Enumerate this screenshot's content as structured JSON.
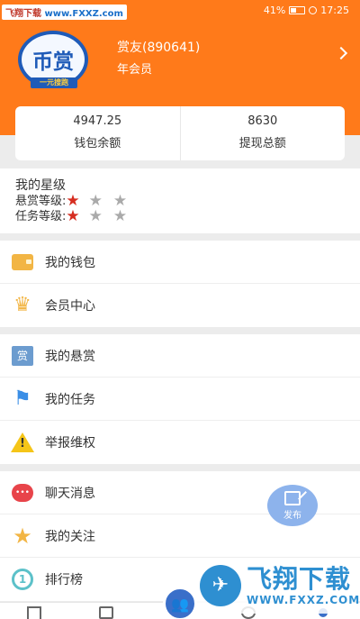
{
  "status_bar": {
    "watermark_name": "飞翔下载",
    "watermark_url": "www.FXXZ.com",
    "battery": "41%",
    "time": "17:25"
  },
  "profile": {
    "avatar_text": "币赏",
    "avatar_ribbon": "一元搜跑",
    "name": "赏友(890641)",
    "membership": "年会员"
  },
  "stats": [
    {
      "value": "4947.25",
      "label": "钱包余额"
    },
    {
      "value": "8630",
      "label": "提现总额"
    }
  ],
  "rating": {
    "title": "我的星级",
    "rows": [
      {
        "label": "悬赏等级:",
        "filled": 1,
        "total": 3
      },
      {
        "label": "任务等级:",
        "filled": 1,
        "total": 3
      }
    ]
  },
  "menu_groups": [
    [
      {
        "id": "wallet",
        "label": "我的钱包",
        "icon": "wallet-icon"
      },
      {
        "id": "member",
        "label": "会员中心",
        "icon": "crown-icon"
      }
    ],
    [
      {
        "id": "reward",
        "label": "我的悬赏",
        "icon": "reward-badge-icon",
        "icon_text": "赏"
      },
      {
        "id": "task",
        "label": "我的任务",
        "icon": "flag-icon"
      },
      {
        "id": "report",
        "label": "举报维权",
        "icon": "warning-icon"
      }
    ],
    [
      {
        "id": "chat",
        "label": "聊天消息",
        "icon": "chat-bubble-icon"
      },
      {
        "id": "follow",
        "label": "我的关注",
        "icon": "star-icon"
      },
      {
        "id": "rank",
        "label": "排行榜",
        "icon": "medal-icon"
      }
    ]
  ],
  "fab": {
    "label": "发布"
  },
  "watermark_br": {
    "text": "飞翔下载",
    "url": "WWW.FXXZ.COM"
  },
  "colors": {
    "header": "#ff7a1a",
    "star_on": "#d62d20",
    "star_off": "#aaaaaa",
    "fab": "#8db3ec"
  }
}
